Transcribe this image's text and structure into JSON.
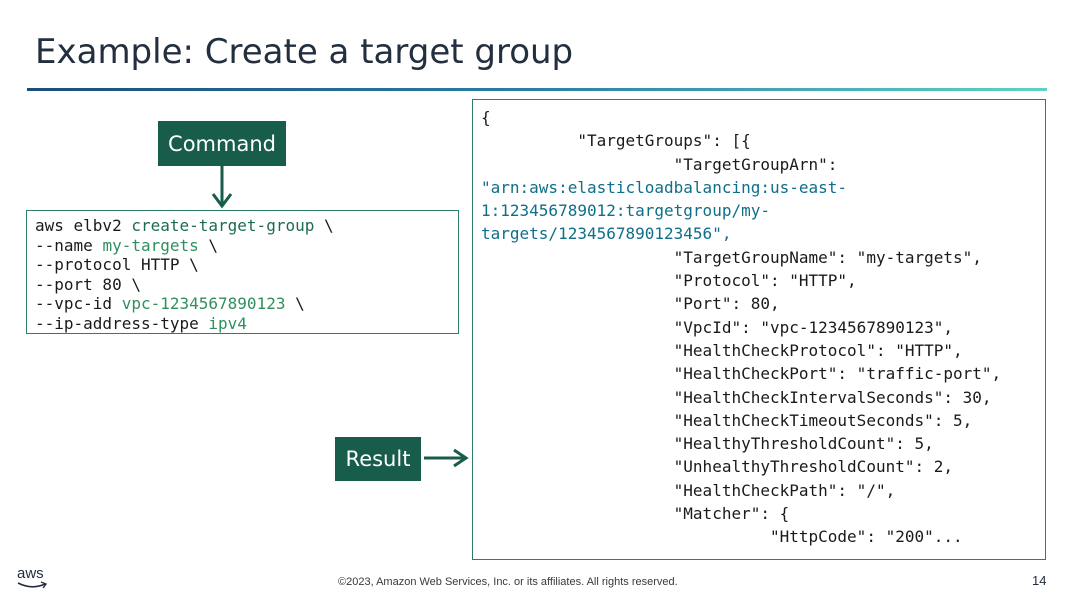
{
  "slide": {
    "title": "Example: Create a target group",
    "command_label": "Command",
    "result_label": "Result",
    "footer": {
      "logo_text": "aws",
      "copyright": "©2023, Amazon Web Services, Inc. or its affiliates. All rights reserved.",
      "page_number": "14"
    }
  },
  "command_lines": [
    [
      {
        "t": "aws elbv2 ",
        "s": "plain"
      },
      {
        "t": "create-target-group",
        "s": "accent"
      },
      {
        "t": " \\",
        "s": "plain"
      }
    ],
    [
      {
        "t": "--name ",
        "s": "plain"
      },
      {
        "t": "my-targets",
        "s": "green"
      },
      {
        "t": " \\",
        "s": "plain"
      }
    ],
    [
      {
        "t": "--protocol HTTP \\",
        "s": "plain"
      }
    ],
    [
      {
        "t": "--port 80 \\",
        "s": "plain"
      }
    ],
    [
      {
        "t": "--vpc-id ",
        "s": "plain"
      },
      {
        "t": "vpc-1234567890123",
        "s": "green"
      },
      {
        "t": " \\",
        "s": "plain"
      }
    ],
    [
      {
        "t": "--ip-address-type ",
        "s": "plain"
      },
      {
        "t": "ipv4",
        "s": "green"
      }
    ]
  ],
  "result_lines": [
    {
      "text": "{",
      "indent": 0
    },
    {
      "text": "\"TargetGroups\": [{",
      "indent": 1
    },
    {
      "text": "\"TargetGroupArn\":",
      "indent": 2
    },
    {
      "text": "\"arn:aws:elasticloadbalancing:us-east-",
      "indent": 0,
      "kind": "arn"
    },
    {
      "text": "1:123456789012:targetgroup/my-",
      "indent": 0,
      "kind": "arn"
    },
    {
      "text": "targets/1234567890123456\",",
      "indent": 0,
      "kind": "arn"
    },
    {
      "text": "\"TargetGroupName\": \"my-targets\",",
      "indent": 2
    },
    {
      "text": "\"Protocol\": \"HTTP\",",
      "indent": 2
    },
    {
      "text": "\"Port\": 80,",
      "indent": 2
    },
    {
      "text": "\"VpcId\": \"vpc-1234567890123\",",
      "indent": 2
    },
    {
      "text": "\"HealthCheckProtocol\": \"HTTP\",",
      "indent": 2
    },
    {
      "text": "\"HealthCheckPort\": \"traffic-port\",",
      "indent": 2
    },
    {
      "text": "\"HealthCheckIntervalSeconds\": 30,",
      "indent": 2
    },
    {
      "text": "\"HealthCheckTimeoutSeconds\": 5,",
      "indent": 2
    },
    {
      "text": "\"HealthyThresholdCount\": 5,",
      "indent": 2
    },
    {
      "text": "\"UnhealthyThresholdCount\": 2,",
      "indent": 2
    },
    {
      "text": "\"HealthCheckPath\": \"/\",",
      "indent": 2
    },
    {
      "text": "\"Matcher\": {",
      "indent": 2
    },
    {
      "text": "\"HttpCode\": \"200\"...",
      "indent": 3
    }
  ],
  "colors": {
    "label_bg": "#185c4c",
    "border": "#2e7d6a",
    "arn_text": "#0f6e8a",
    "accent_text": "#1e6b52"
  }
}
